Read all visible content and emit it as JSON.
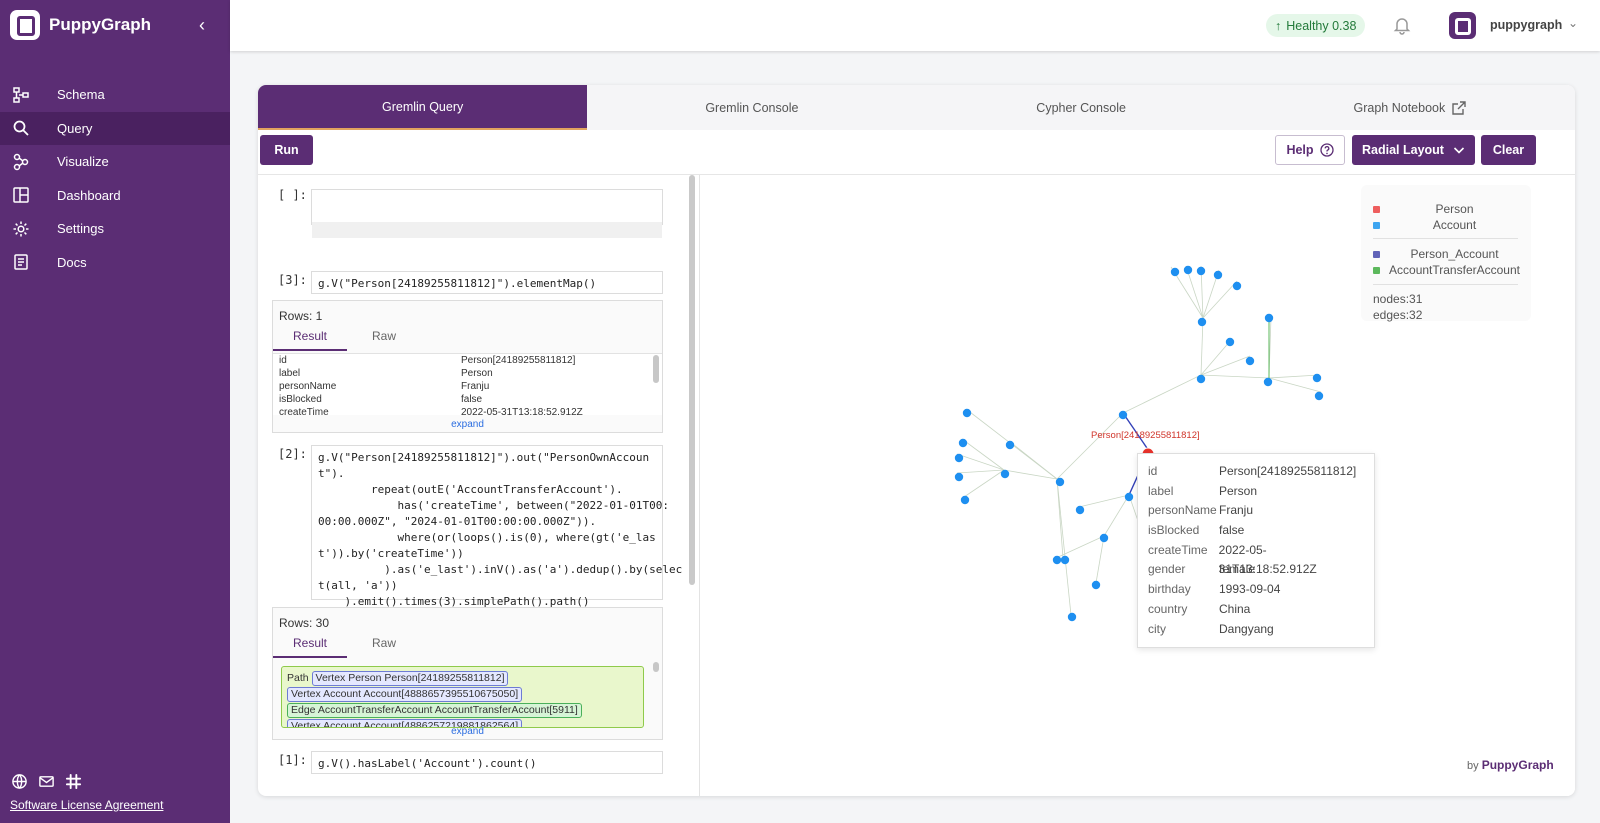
{
  "app": {
    "name": "PuppyGraph"
  },
  "sidebar": {
    "items": [
      {
        "label": "Schema",
        "icon": "schema-icon"
      },
      {
        "label": "Query",
        "icon": "search-icon"
      },
      {
        "label": "Visualize",
        "icon": "visualize-icon"
      },
      {
        "label": "Dashboard",
        "icon": "dashboard-icon"
      },
      {
        "label": "Settings",
        "icon": "gear-icon"
      },
      {
        "label": "Docs",
        "icon": "docs-icon"
      }
    ],
    "active": "Query",
    "bottom_icons": [
      "globe-icon",
      "mail-icon",
      "slack-icon"
    ],
    "license_link": "Software License Agreement"
  },
  "header": {
    "health_label": "Healthy 0.38",
    "health_color": "#237a3a",
    "username": "puppygraph"
  },
  "tabs": [
    {
      "label": "Gremlin Query",
      "active": true
    },
    {
      "label": "Gremlin Console",
      "active": false
    },
    {
      "label": "Cypher Console",
      "active": false
    },
    {
      "label": "Graph Notebook",
      "active": false
    }
  ],
  "toolbar": {
    "run_label": "Run",
    "help_label": "Help",
    "layout_label": "Radial Layout",
    "clear_label": "Clear"
  },
  "cells": {
    "empty_prompt": "[ ]:",
    "cell3": {
      "prompt": "[3]:",
      "code": "g.V(\"Person[24189255811812]\").elementMap()",
      "rows_label": "Rows: 1",
      "tab_result": "Result",
      "tab_raw": "Raw",
      "table": [
        [
          "id",
          "Person[24189255811812]"
        ],
        [
          "label",
          "Person"
        ],
        [
          "personName",
          "Franju"
        ],
        [
          "isBlocked",
          "false"
        ],
        [
          "createTime",
          "2022-05-31T13:18:52.912Z"
        ]
      ],
      "expand_label": "expand"
    },
    "cell2": {
      "prompt": "[2]:",
      "code": "g.V(\"Person[24189255811812]\").out(\"PersonOwnAccoun\nt\").\n        repeat(outE('AccountTransferAccount').\n            has('createTime', between(\"2022-01-01T00:\n00:00.000Z\", \"2024-01-01T00:00:00.000Z\")).\n            where(or(loops().is(0), where(gt('e_las\nt')).by('createTime'))\n          ).as('e_last').inV().as('a').dedup().by(selec\nt(all, 'a'))\n    ).emit().times(3).simplePath().path()",
      "rows_label": "Rows: 30",
      "tab_result": "Result",
      "tab_raw": "Raw",
      "path_label": "Path",
      "path_items": [
        "Vertex Person Person[24189255811812]",
        "Vertex Account Account[4888657395510675050]",
        "Edge AccountTransferAccount AccountTransferAccount[5911]",
        "Vertex Account Account[4886257219881862564]"
      ],
      "expand_label": "expand"
    },
    "cell1": {
      "prompt": "[1]:",
      "code": "g.V().hasLabel('Account').count()"
    }
  },
  "legend": {
    "vertex_types": [
      {
        "label": "Person",
        "color": "#ee5e5e"
      },
      {
        "label": "Account",
        "color": "#3ea5f0"
      }
    ],
    "edge_types": [
      {
        "label": "Person_Account",
        "color": "#6163b8"
      },
      {
        "label": "AccountTransferAccount",
        "color": "#5cb85c"
      }
    ],
    "nodes": "nodes:31",
    "edges": "edges:32"
  },
  "graph": {
    "highlight_label": "Person[24189255811812]",
    "node_color": "#1e8ff0",
    "highlight_color": "#e8322b"
  },
  "tooltip": {
    "rows": [
      [
        "id",
        "Person[24189255811812]"
      ],
      [
        "label",
        "Person"
      ],
      [
        "personName",
        "Franju"
      ],
      [
        "isBlocked",
        "false"
      ],
      [
        "createTime",
        "2022-05-31T13:18:52.912Z"
      ],
      [
        "gender",
        "female"
      ],
      [
        "birthday",
        "1993-09-04"
      ],
      [
        "country",
        "China"
      ],
      [
        "city",
        "Dangyang"
      ]
    ]
  },
  "byline": {
    "prefix": "by",
    "brand": "PuppyGraph"
  }
}
